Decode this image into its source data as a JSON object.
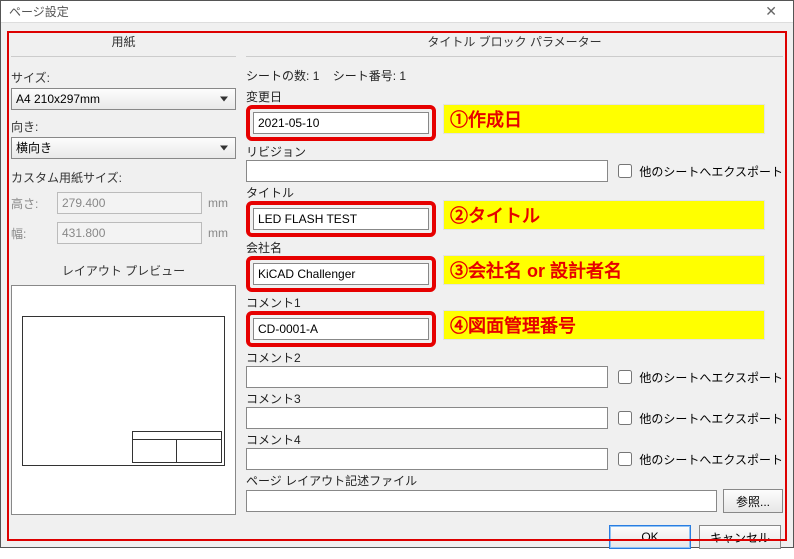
{
  "window": {
    "title": "ページ設定"
  },
  "left": {
    "header": "用紙",
    "size_label": "サイズ:",
    "size_value": "A4 210x297mm",
    "orient_label": "向き:",
    "orient_value": "横向き",
    "custom_header": "カスタム用紙サイズ:",
    "height_label": "高さ:",
    "height_value": "279.400",
    "width_label": "幅:",
    "width_value": "431.800",
    "unit": "mm",
    "preview_header": "レイアウト プレビュー"
  },
  "right": {
    "header": "タイトル ブロック パラメーター",
    "sheet_count_label": "シートの数:",
    "sheet_count": "1",
    "sheet_no_label": "シート番号:",
    "sheet_no": "1",
    "date_label": "変更日",
    "date_value": "2021-05-10",
    "rev_label": "リビジョン",
    "rev_value": "",
    "title_label": "タイトル",
    "title_value": "LED FLASH TEST",
    "company_label": "会社名",
    "company_value": "KiCAD Challenger",
    "c1_label": "コメント1",
    "c1_value": "CD-0001-A",
    "c2_label": "コメント2",
    "c2_value": "",
    "c3_label": "コメント3",
    "c3_value": "",
    "c4_label": "コメント4",
    "c4_value": "",
    "layoutfile_label": "ページ レイアウト記述ファイル",
    "layoutfile_value": "",
    "browse": "参照...",
    "export_other": "他のシートへエクスポート"
  },
  "annotations": {
    "a1": "①作成日",
    "a2": "②タイトル",
    "a3": "③会社名 or 設計者名",
    "a4": "④図面管理番号"
  },
  "buttons": {
    "ok": "OK",
    "cancel": "キャンセル"
  }
}
